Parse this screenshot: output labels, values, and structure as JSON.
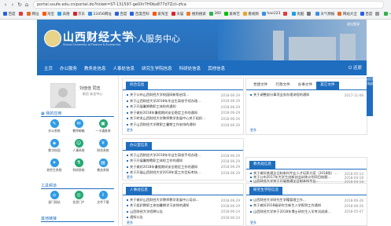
{
  "browser": {
    "url": "portal.sxufe.edu.cn/portal.do?ticket=ST-131597-ge0Xr7H0bx877d7Zcli-zfca",
    "bookmarks": [
      {
        "label": "百度",
        "color": "#2b5ee3"
      },
      {
        "label": "",
        "color": "#e03a3a"
      },
      {
        "label": "网址",
        "color": "#e96a2c"
      },
      {
        "label": "淘宝",
        "color": "#ff5500"
      },
      {
        "label": "高德",
        "color": "#2aa1f5"
      },
      {
        "label": "京东",
        "color": "#d8232a"
      },
      {
        "label": "23456网址",
        "color": "#3a8ee6"
      },
      {
        "label": "百度",
        "color": "#2b5ee3"
      },
      {
        "label": "百度百科",
        "color": "#2b5ee3"
      },
      {
        "label": "爱淘宝",
        "color": "#ff5500"
      },
      {
        "label": "天猫",
        "color": "#d8232a"
      },
      {
        "label": "搜狗搜索",
        "color": "#ee7a2c"
      },
      {
        "label": "360",
        "color": "#2fb34a"
      },
      {
        "label": "爱奇艺",
        "color": "#00be06"
      },
      {
        "label": "看视频",
        "color": "#e9a52c"
      },
      {
        "label": "hao123",
        "color": "#3a8ee6"
      },
      {
        "label": "",
        "color": "#e03a3a"
      },
      {
        "label": "优酷",
        "color": "#1f9fe5"
      },
      {
        "label": "",
        "color": "#777"
      },
      {
        "label": "天气预报",
        "color": "#3a8ee6"
      },
      {
        "label": "网站大全",
        "color": "#e96a2c"
      },
      {
        "label": "百度",
        "color": "#2b5ee3"
      },
      {
        "label": "",
        "color": "#999"
      },
      {
        "label": "一分钟链接",
        "color": "#2fb34a"
      },
      {
        "label": "",
        "color": "#e03a3a"
      },
      {
        "label": "",
        "color": "#2b5ee3"
      },
      {
        "label": "",
        "color": "#777"
      }
    ]
  },
  "banner": {
    "logo_cn": "山西财经大学",
    "logo_en": "Shanxi University of Finance & Economics",
    "portal_title": "个人服务中心",
    "login_link": "退出登录"
  },
  "nav": {
    "items": [
      "主页",
      "办公服务",
      "教务处信息",
      "人事处信息",
      "研究生学院信息",
      "科研处信息",
      "其他信息"
    ],
    "exit": "还原"
  },
  "user": {
    "name": "刘佳佳 同志",
    "role": "职员  安全中心"
  },
  "my_apps": {
    "title": "我的应用",
    "apps": [
      {
        "label": "办公系统",
        "color": "#2e9be5",
        "icon": "✎"
      },
      {
        "label": "教师邮箱",
        "color": "#2e9be5",
        "icon": "✉"
      },
      {
        "label": "一卡通查询",
        "color": "#23a873",
        "icon": "▣"
      },
      {
        "label": "数字校园",
        "color": "#2e9be5",
        "icon": "◈"
      },
      {
        "label": "人事系统",
        "color": "#23a873",
        "icon": "☺"
      },
      {
        "label": "财务系统",
        "color": "#2e9be5",
        "icon": "¥"
      },
      {
        "label": "研究生系统",
        "color": "#2e9be5",
        "icon": "✦"
      },
      {
        "label": "科研系统",
        "color": "#23a873",
        "icon": "⚗"
      },
      {
        "label": "教务系统",
        "color": "#2e9be5",
        "icon": "▤"
      }
    ]
  },
  "common_links": {
    "title": "工具频道",
    "items": [
      {
        "label": "部门网站",
        "color": "#2e9be5",
        "icon": "⌂"
      },
      {
        "label": "信息门户",
        "color": "#23a873",
        "icon": "◎"
      },
      {
        "label": "文件下载",
        "color": "#2e9be5",
        "icon": "⇩"
      }
    ]
  },
  "other_title": "其他链接",
  "panels": {
    "news": {
      "title": "综合信息",
      "rows": [
        {
          "t": "关于公布山西财经大学校园网新版启用...",
          "d": "2018-06-29"
        },
        {
          "t": "关于山西财经大学2018年毕业生离校手续办理...",
          "d": "2018-06-29"
        },
        {
          "t": "关于开展暑期教职工体检的通知",
          "d": "2018-06-29"
        },
        {
          "t": "关于做好2018年暑假期间安全稳定工作的通知",
          "d": "2018-06-29"
        },
        {
          "t": "关于转发山西财经大学教师教学发展中心关于组织...",
          "d": "2018-06-26"
        },
        {
          "t": "关于山西财经大学教职工暑期工作安排的通知",
          "d": "2018-06-26"
        }
      ],
      "more": "更多"
    },
    "office": {
      "title": "办公室信息",
      "rows": [
        {
          "t": "关于山西财经大学2018年毕业生离校手续办理...",
          "d": "2018-06-29"
        },
        {
          "t": "关于开展暑期教职工体检工作的通知",
          "d": "2018-06-29"
        },
        {
          "t": "关于做好2018年暑假期间安全稳定工作的通知",
          "d": "2018-06-29"
        },
        {
          "t": "关于开展山西财经大学2018年度工作目标考核...",
          "d": "2018-06-29"
        }
      ],
      "more": "更多"
    },
    "hr": {
      "title": "人事处信息",
      "rows": [
        {
          "t": "关于做好山西财经大学教师教学发展中心培训...",
          "d": "2018-06-29"
        },
        {
          "t": "关于组织教职工参加暑期学习安排的通知",
          "d": "2018-06-29"
        },
        {
          "t": "山西财经大学招聘公告",
          "d": "2018-06-24"
        },
        {
          "t": "通知公告",
          "d": "2018-06-24"
        }
      ],
      "more": "更多"
    },
    "docs": {
      "tabs": [
        "党建文件",
        "行政文件",
        "办事文件",
        "其它文件"
      ],
      "active_tab": 3,
      "rows": [
        {
          "t": "关于调整部分事项业务办理流程的通知",
          "d": "2017-11-08"
        }
      ],
      "more": "更多"
    },
    "academic": {
      "title": "教务处信息",
      "rows": [
        {
          "t": "关于做好普通全日制本科专业人才培养方案（2018版）...",
          "d": "2018-05-14"
        },
        {
          "t": "关于公布2017年大学生创新创业训练计划项目结题...",
          "d": "2018-04-18"
        },
        {
          "t": "山西财经大学关于开展普通全日制本科专业...",
          "d": "2018-04-18"
        }
      ],
      "more": "更多"
    },
    "grad": {
      "title": "研究生学院信息",
      "rows": [
        {
          "t": "山西财经大学研究生学籍管理工作...",
          "d": "2018-06-26"
        },
        {
          "t": "关于做好2018级研究生新生入学报到工作通知",
          "d": "2018-06-26"
        },
        {
          "t": "山西财经大学关于2018年博士研究生入学考试成绩...",
          "d": "2018-05-07"
        }
      ],
      "more": "更多"
    }
  },
  "side_tab": "返回顶部"
}
